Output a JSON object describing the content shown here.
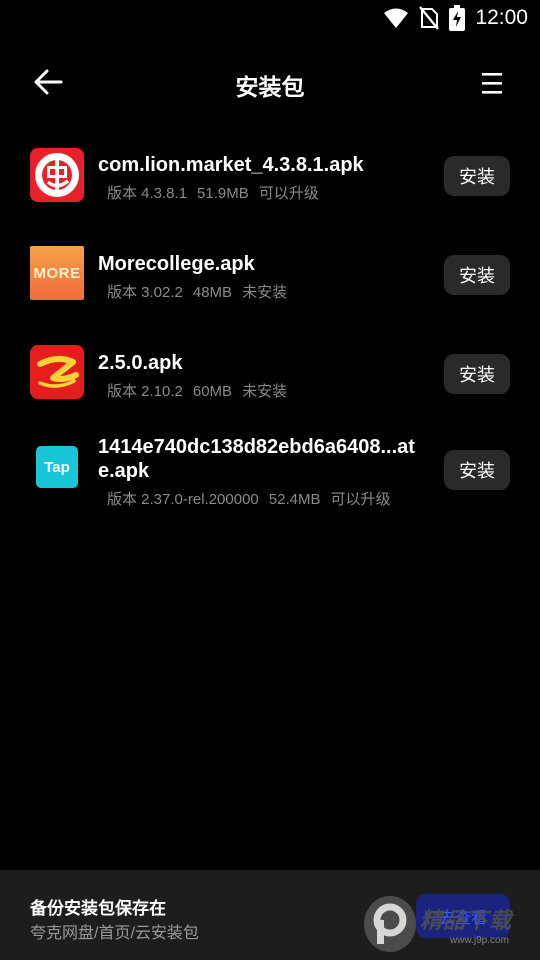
{
  "status_bar": {
    "time": "12:00",
    "icons": [
      "wifi-icon",
      "no-sim-icon",
      "battery-charging-icon"
    ]
  },
  "app_bar": {
    "title": "安装包",
    "back_icon": "arrow-left-icon",
    "menu_icon": "menu-icon"
  },
  "packages": [
    {
      "name": "com.lion.market_4.3.8.1.apk",
      "version": "版本 4.3.8.1",
      "size": "51.9MB",
      "status": "可以升级",
      "icon": "chong-app-icon",
      "icon_color": "#e8202a",
      "button": "安装"
    },
    {
      "name": "Morecollege.apk",
      "version": "版本 3.02.2",
      "size": "48MB",
      "status": "未安装",
      "icon": "more-app-icon",
      "icon_label": "MORE",
      "icon_color": "#f58a3d",
      "button": "安装"
    },
    {
      "name": "2.5.0.apk",
      "version": "版本 2.10.2",
      "size": "60MB",
      "status": "未安装",
      "icon": "z-app-icon",
      "icon_color": "#e51d1d",
      "button": "安装"
    },
    {
      "name": "1414e740dc138d82ebd6a6408...ate.apk",
      "version": "版本 2.37.0-rel.200000",
      "size": "52.4MB",
      "status": "可以升级",
      "icon": "tap-app-icon",
      "icon_label": "Tap",
      "icon_color": "#19c6d8",
      "button": "安装"
    }
  ],
  "bottom_bar": {
    "title": "备份安装包保存在",
    "path": "夸克网盘/首页/云安装包",
    "button": "去查看"
  },
  "watermark": {
    "main": "精品下载",
    "sub": "www.j9p.com"
  }
}
